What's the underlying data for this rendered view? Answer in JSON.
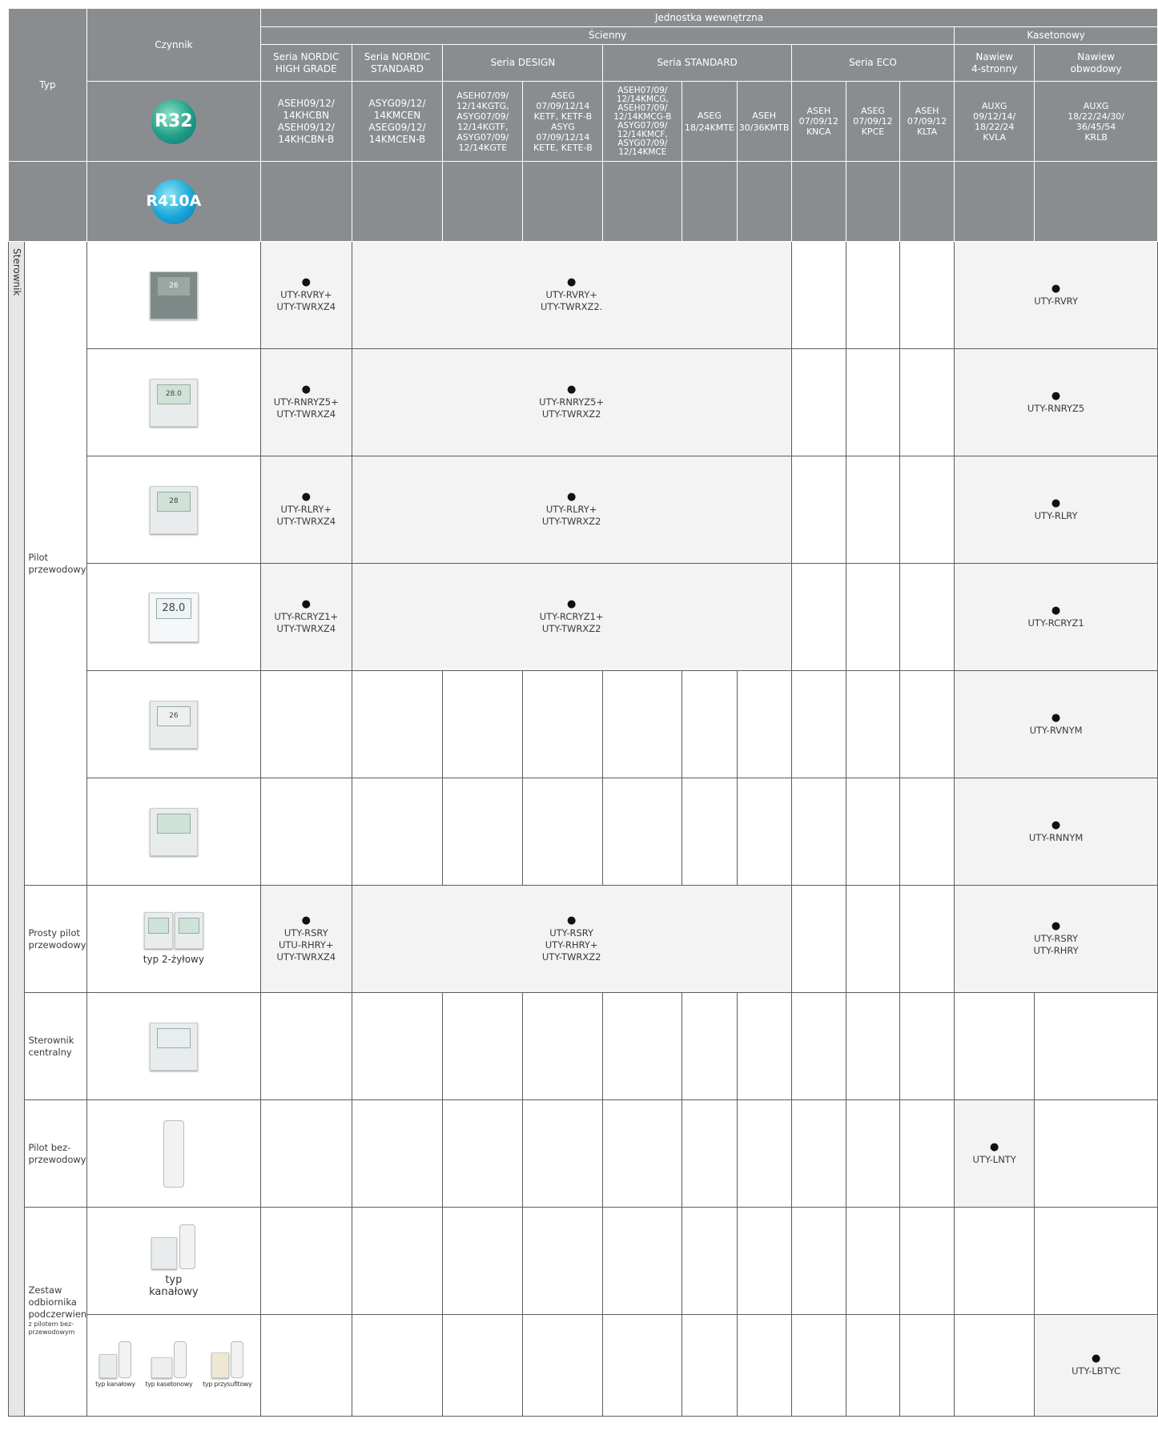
{
  "header": {
    "typ": "Typ",
    "czynnik": "Czynnik",
    "jednostka": "Jednostka wewnętrzna",
    "scienny": "Ścienny",
    "kasetonowy": "Kasetonowy",
    "refrigerants": [
      "R32",
      "R410A"
    ],
    "series": [
      {
        "label": "Seria NORDIC\nHIGH GRADE"
      },
      {
        "label": "Seria NORDIC\nSTANDARD"
      },
      {
        "label": "Seria DESIGN"
      },
      {
        "label": "Seria STANDARD"
      },
      {
        "label": "Seria ECO"
      },
      {
        "label": "Nawiew\n4-stronny"
      },
      {
        "label": "Nawiew\nobwodowy"
      }
    ],
    "models": [
      "ASEH09/12/\n14KHCBN\nASEH09/12/\n14KHCBN-B",
      "ASYG09/12/\n14KMCEN\nASEG09/12/\n14KMCEN-B",
      "ASEH07/09/\n12/14KGTG,\nASYG07/09/\n12/14KGTF,\nASYG07/09/\n12/14KGTE",
      "ASEG\n07/09/12/14\nKETF, KETF-B\nASYG\n07/09/12/14\nKETE, KETE-B",
      "ASEH07/09/\n12/14KMCG,\nASEH07/09/\n12/14KMCG-B\nASYG07/09/\n12/14KMCF,\nASYG07/09/\n12/14KMCE",
      "ASEG\n18/24KMTE",
      "ASEH\n30/36KMTB",
      "ASEH\n07/09/12\nKNCA",
      "ASEG\n07/09/12\nKPCE",
      "ASEH\n07/09/12\nKLTA",
      "AUXG\n09/12/14/\n18/22/24\nKVLA",
      "AUXG\n18/22/24/30/\n36/45/54\nKRLB"
    ]
  },
  "side_label": "Sterownik",
  "groups": {
    "pilot_przewodowy": "Pilot\nprzewodowy",
    "prosty_pilot": "Prosty pilot\nprzewodowy",
    "sterownik_centralny": "Sterownik\ncentralny",
    "pilot_bez": "Pilot bez-\nprzewodowy",
    "zestaw": "Zestaw\nodbiornika\npodczerwieni",
    "zestaw_note": "z pilotem bez-\nprzewodowym"
  },
  "captions": {
    "typ_2zylowy": "typ 2-żyłowy",
    "typ_kanalowy": "typ\nkanałowy",
    "typ_kanalowy_s": "typ kanałowy",
    "typ_kasetonowy_s": "typ kasetonowy",
    "typ_przysufitowy_s": "typ przysufitowy"
  },
  "device_screens": [
    "26",
    "28.0",
    "28",
    "28.0",
    "26",
    "",
    "",
    "",
    ""
  ],
  "dot": "●",
  "rows": {
    "r1": {
      "a": "UTY-RVRY+\nUTY-TWRXZ4",
      "b": "UTY-RVRY+\nUTY-TWRXZ2.",
      "k": "UTY-RVRY"
    },
    "r2": {
      "a": "UTY-RNRYZ5+\nUTY-TWRXZ4",
      "b": "UTY-RNRYZ5+\nUTY-TWRXZ2",
      "k": "UTY-RNRYZ5"
    },
    "r3": {
      "a": "UTY-RLRY+\nUTY-TWRXZ4",
      "b": "UTY-RLRY+\nUTY-TWRXZ2",
      "k": "UTY-RLRY"
    },
    "r4": {
      "a": "UTY-RCRYZ1+\nUTY-TWRXZ4",
      "b": "UTY-RCRYZ1+\nUTY-TWRXZ2",
      "k": "UTY-RCRYZ1"
    },
    "r5": {
      "k": "UTY-RVNYM"
    },
    "r6": {
      "k": "UTY-RNNYM"
    },
    "r7": {
      "a": "UTY-RSRY\nUTU-RHRY+\nUTY-TWRXZ4",
      "b": "UTY-RSRY\nUTY-RHRY+\nUTY-TWRXZ2",
      "k": "UTY-RSRY\nUTY-RHRY"
    },
    "r9": {
      "k": "UTY-LNTY"
    },
    "r11": {
      "k": "UTY-LBTYC"
    }
  }
}
